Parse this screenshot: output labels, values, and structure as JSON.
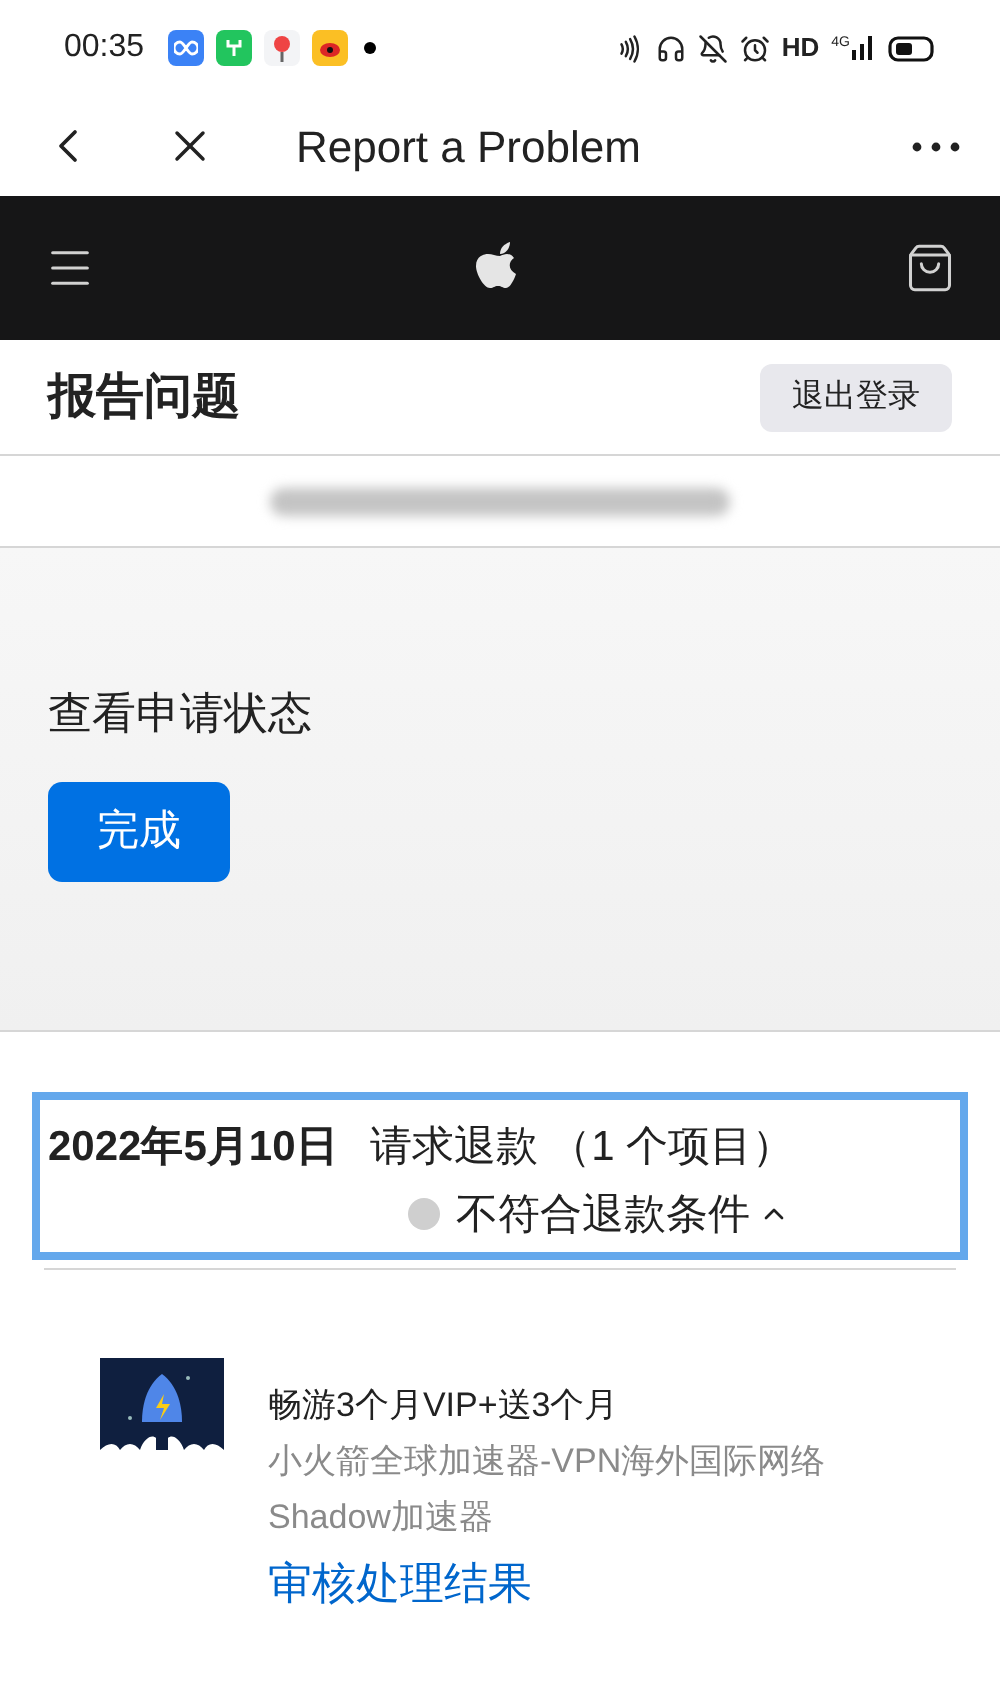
{
  "status_bar": {
    "time": "00:35",
    "network_label": "HD",
    "signal_label": "4G"
  },
  "nav": {
    "title": "Report a Problem"
  },
  "header": {
    "title": "报告问题",
    "sign_out": "退出登录"
  },
  "status_section": {
    "heading": "查看申请状态",
    "done_button": "完成"
  },
  "request": {
    "date": "2022年5月10日",
    "summary": "请求退款 （1 个项目）",
    "highlighted": true,
    "status": {
      "label": "不符合退款条件",
      "color": "#cfcfcf",
      "expanded": true
    }
  },
  "item": {
    "name": "畅游3个月VIP+送3个月",
    "app": "小火箭全球加速器-VPN海外国际网络Shadow加速器",
    "link": "审核处理结果"
  }
}
